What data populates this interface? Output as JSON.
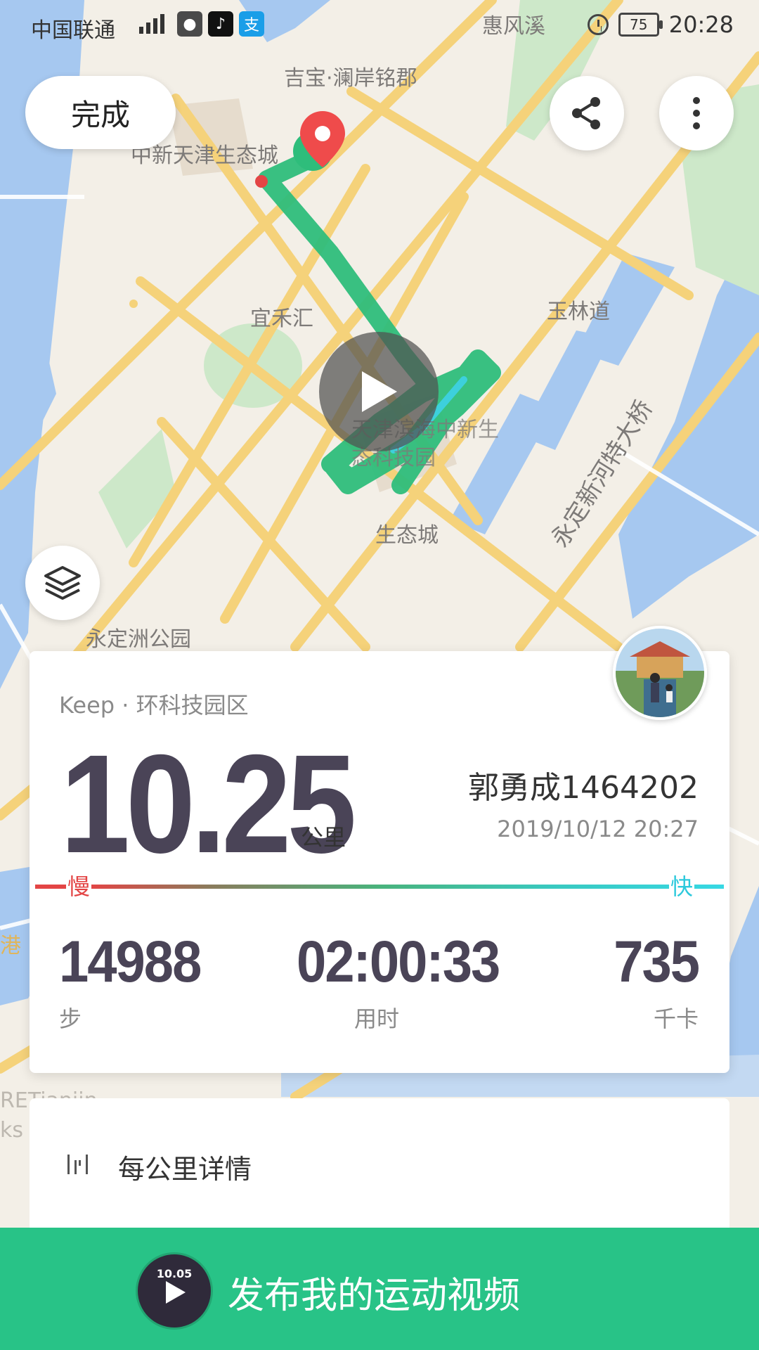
{
  "status_bar": {
    "carrier": "中国联通",
    "battery": "75",
    "time": "20:28"
  },
  "map": {
    "labels": {
      "huifengxi": "惠风溪",
      "jibao": "吉宝·澜岸铭郡",
      "zhongxin": "中新天津生态城",
      "yihehui": "宜禾汇",
      "yulindao": "玉林道",
      "tech_park": "天津滨海中新生态科技园",
      "shengtaicheng": "生态城",
      "bridge": "永定新河特大桥",
      "park": "永定洲公园",
      "gang": "港",
      "ret": "RETianjin",
      "ks": "ks"
    },
    "route_color": "#2ebd7b",
    "pin_color": "#ef4b4b"
  },
  "controls": {
    "done_label": "完成"
  },
  "summary": {
    "source": "Keep · 环科技园区",
    "distance": "10.25",
    "distance_unit": "公里",
    "username": "郭勇成1464202",
    "datetime": "2019/10/12 20:27",
    "slow_label": "慢",
    "fast_label": "快",
    "steps": "14988",
    "steps_label": "步",
    "duration": "02:00:33",
    "duration_label": "用时",
    "calories": "735",
    "calories_label": "千卡"
  },
  "details": {
    "title": "每公里详情"
  },
  "publish": {
    "label": "发布我的运动视频",
    "thumb_distance": "10.05"
  }
}
